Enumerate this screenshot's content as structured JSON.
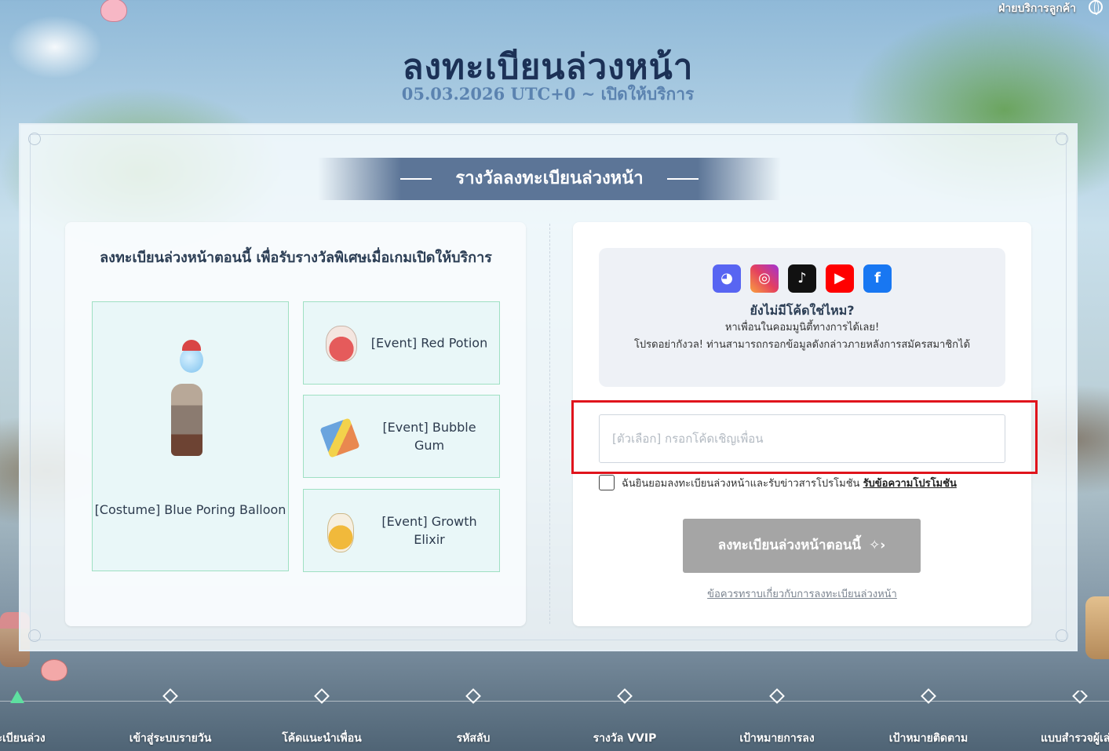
{
  "header": {
    "title": "ลงทะเบียนล่วงหน้า",
    "subtitle": "05.03.2026 UTC+0 ~ เปิดให้บริการ",
    "customer_service": "ฝ่ายบริการลูกค้า"
  },
  "section_title": "รางวัลลงทะเบียนล่วงหน้า",
  "rewards": {
    "heading": "ลงทะเบียนล่วงหน้าตอนนี้ เพื่อรับรางวัลพิเศษเมื่อเกมเปิดให้บริการ",
    "items": [
      {
        "label": "[Costume] Blue Poring Balloon",
        "icon": "blue-poring-balloon-icon"
      },
      {
        "label": "[Event] Red Potion",
        "icon": "red-potion-icon"
      },
      {
        "label": "[Event] Bubble Gum",
        "icon": "bubble-gum-icon"
      },
      {
        "label": "[Event] Growth Elixir",
        "icon": "growth-elixir-icon"
      }
    ]
  },
  "community": {
    "socials": [
      {
        "name": "discord",
        "glyph": "◕"
      },
      {
        "name": "instagram",
        "glyph": "◎"
      },
      {
        "name": "tiktok",
        "glyph": "♪"
      },
      {
        "name": "youtube",
        "glyph": "▶"
      },
      {
        "name": "facebook",
        "glyph": "f"
      }
    ],
    "title": "ยังไม่มีโค้ดใช่ไหม?",
    "line1": "หาเพื่อนในคอมมูนิตี้ทางการได้เลย!",
    "line2": "โปรดอย่ากังวล! ท่านสามารถกรอกข้อมูลดังกล่าวภายหลังการสมัครสมาชิกได้"
  },
  "form": {
    "invite_placeholder": "[ตัวเลือก] กรอกโค้ดเชิญเพื่อน",
    "invite_value": "",
    "consent_text": "ฉันยินยอมลงทะเบียนล่วงหน้าและรับข่าวสารโปรโมชัน",
    "consent_link": "รับข้อความโปรโมชัน",
    "consent_checked": false,
    "submit_label": "ลงทะเบียนล่วงหน้าตอนนี้",
    "notice_link": "ข้อควรทราบเกี่ยวกับการลงทะเบียนล่วงหน้า"
  },
  "bottom_nav": [
    {
      "label": "ทะเบียนล่วง",
      "active": true
    },
    {
      "label": "เข้าสู่ระบบรายวัน",
      "active": false
    },
    {
      "label": "โค้ดแนะนำเพื่อน",
      "active": false
    },
    {
      "label": "รหัสลับ",
      "active": false
    },
    {
      "label": "รางวัล VVIP",
      "active": false
    },
    {
      "label": "เป้าหมายการลง",
      "active": false
    },
    {
      "label": "เป้าหมายติดตาม",
      "active": false
    },
    {
      "label": "แบบสำรวจผู้เล่",
      "active": false
    }
  ],
  "colors": {
    "title": "#1c3156",
    "subtitle": "#5b83b0",
    "reward_border": "#9fe0c3",
    "highlight": "#e0141c",
    "submit_disabled": "#a5a5a5"
  }
}
